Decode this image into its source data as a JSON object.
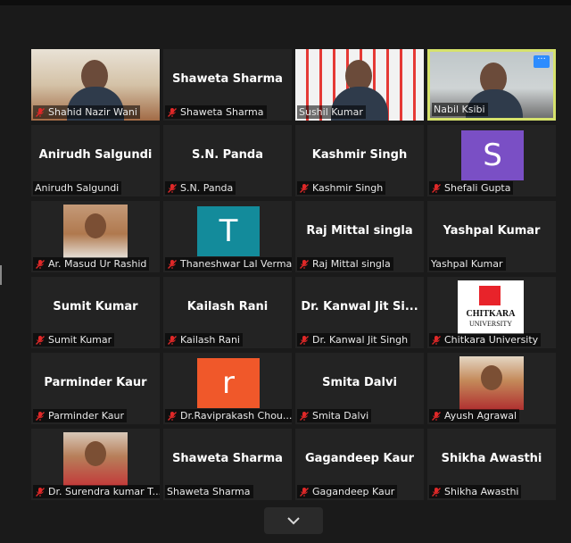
{
  "meeting": {
    "tiles": [
      {
        "name": "Shahid Nazir Wani",
        "label": "Shahid Nazir Wani",
        "muted": true,
        "kind": "video"
      },
      {
        "name": "Shaweta Sharma",
        "label": "Shaweta Sharma",
        "muted": true,
        "kind": "name"
      },
      {
        "name": "Sushil Kumar",
        "label": "Sushil Kumar",
        "muted": false,
        "kind": "video"
      },
      {
        "name": "Nabil Ksibi",
        "label": "Nabil Ksibi",
        "muted": false,
        "kind": "video",
        "active": true
      },
      {
        "name": "Anirudh Salgundi",
        "label": "Anirudh Salgundi",
        "muted": false,
        "kind": "name"
      },
      {
        "name": "S.N. Panda",
        "label": "S.N. Panda",
        "muted": true,
        "kind": "name"
      },
      {
        "name": "Kashmir Singh",
        "label": "Kashmir Singh",
        "muted": true,
        "kind": "name"
      },
      {
        "name": "Shefali Gupta",
        "label": "Shefali Gupta",
        "muted": true,
        "kind": "avatar",
        "avatar_letter": "S",
        "avatar_color": "#7a4fc5"
      },
      {
        "name": "Ar. Masud Ur Rashid",
        "label": "Ar. Masud Ur Rashid",
        "muted": true,
        "kind": "photo"
      },
      {
        "name": "Thaneshwar Lal Verma",
        "label": "Thaneshwar Lal Verma",
        "muted": true,
        "kind": "avatar",
        "avatar_letter": "T",
        "avatar_color": "#138b9b"
      },
      {
        "name": "Raj Mittal singla",
        "label": "Raj Mittal singla",
        "muted": true,
        "kind": "name"
      },
      {
        "name": "Yashpal Kumar",
        "label": "Yashpal Kumar",
        "muted": false,
        "kind": "name"
      },
      {
        "name": "Sumit Kumar",
        "label": "Sumit Kumar",
        "muted": true,
        "kind": "name"
      },
      {
        "name": "Kailash Rani",
        "label": "Kailash Rani",
        "muted": true,
        "kind": "name"
      },
      {
        "name": "Dr. Kanwal Jit Si...",
        "label": "Dr. Kanwal Jit Singh",
        "muted": true,
        "kind": "name"
      },
      {
        "name": "Chitkara University",
        "label": "Chitkara University",
        "muted": true,
        "kind": "logo",
        "logo_text": "CHITKARA",
        "logo_sub": "UNIVERSITY"
      },
      {
        "name": "Parminder Kaur",
        "label": "Parminder Kaur",
        "muted": true,
        "kind": "name"
      },
      {
        "name": "Dr.Raviprakash Chou...",
        "label": "Dr.Raviprakash Chou...",
        "muted": true,
        "kind": "avatar",
        "avatar_letter": "r",
        "avatar_color": "#f0582a"
      },
      {
        "name": "Smita Dalvi",
        "label": "Smita Dalvi",
        "muted": true,
        "kind": "name"
      },
      {
        "name": "Ayush Agrawal",
        "label": "Ayush Agrawal",
        "muted": true,
        "kind": "photo"
      },
      {
        "name": "Dr. Surendra kumar T...",
        "label": "Dr. Surendra kumar T...",
        "muted": true,
        "kind": "photo"
      },
      {
        "name": "Shaweta Sharma",
        "label": "Shaweta Sharma",
        "muted": false,
        "kind": "name"
      },
      {
        "name": "Gagandeep Kaur",
        "label": "Gagandeep Kaur",
        "muted": true,
        "kind": "name"
      },
      {
        "name": "Shikha Awasthi",
        "label": "Shikha Awasthi",
        "muted": true,
        "kind": "name"
      }
    ],
    "more_button_icon": "ellipsis-icon",
    "scroll_button_icon": "chevron-down-icon"
  },
  "colors": {
    "muted_icon": "#e02828",
    "active_border": "#d6e26c",
    "accent": "#2d8cff"
  }
}
